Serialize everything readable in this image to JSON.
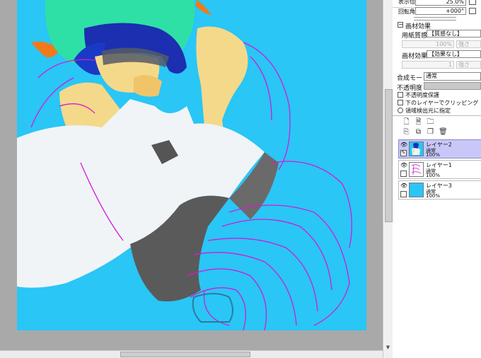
{
  "nav": {
    "display_zoom_label": "表示倍率",
    "display_zoom_value": "25.0%",
    "rotation_label": "回転角度",
    "rotation_value": "+000°"
  },
  "paper_effect": {
    "header": "画材効果",
    "texture_label": "用紙質感",
    "texture_value": "【質感なし】",
    "scale_value": "100%",
    "strength_label": "強さ",
    "material_label": "画材効果",
    "material_value": "【効果なし】",
    "material_amount": "1"
  },
  "layer_props": {
    "blend_mode_label": "合成モード",
    "blend_mode_value": "通常",
    "opacity_label": "不透明度",
    "preserve_opacity": "不透明度保護",
    "clipping": "下のレイヤーでクリッピング",
    "selection_source": "領域検出元に指定"
  },
  "layers": [
    {
      "name": "レイヤー2",
      "mode": "通常",
      "opacity": "100%",
      "selected": true
    },
    {
      "name": "レイヤー1",
      "mode": "通常",
      "opacity": "100%",
      "selected": false
    },
    {
      "name": "レイヤー3",
      "mode": "通常",
      "opacity": "100%",
      "selected": false
    }
  ],
  "colors": {
    "canvas_bg": "#29c6f6",
    "layer_selected": "#c8c8f8",
    "workspace": "#a9a9a9"
  },
  "icons": [
    "new-layer-icon",
    "new-linework-layer-icon",
    "new-folder-icon",
    "transfer-down-icon",
    "merge-down-icon",
    "merge-visible-icon",
    "delete-layer-icon",
    "eye-icon",
    "lock-icon"
  ]
}
